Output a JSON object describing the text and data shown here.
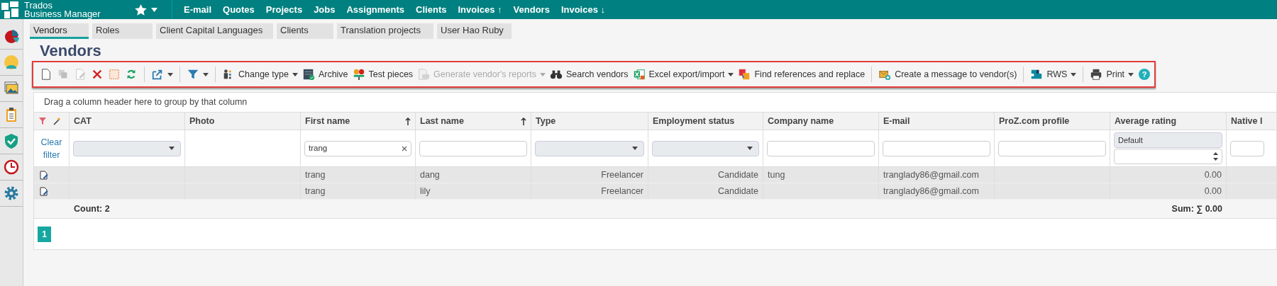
{
  "app": {
    "logo_line_1": "Trados",
    "logo_line_2": "Business Manager"
  },
  "nav": [
    "E-mail",
    "Quotes",
    "Projects",
    "Jobs",
    "Assignments",
    "Clients",
    "Invoices ↑",
    "Vendors",
    "Invoices ↓"
  ],
  "tabs": [
    {
      "label": "Vendors",
      "selected": true
    },
    {
      "label": "Roles",
      "selected": false
    },
    {
      "label": "Client Capital Languages",
      "selected": false
    },
    {
      "label": "Clients",
      "selected": false
    },
    {
      "label": "Translation projects",
      "selected": false
    },
    {
      "label": "User Hao Ruby",
      "selected": false
    }
  ],
  "page_title": "Vendors",
  "toolbar": [
    {
      "kind": "button",
      "disabled": false,
      "menu": false
    },
    {
      "kind": "button",
      "disabled": true,
      "menu": false
    },
    {
      "kind": "button",
      "disabled": true,
      "menu": false
    },
    {
      "kind": "button",
      "disabled": false,
      "menu": false
    },
    {
      "kind": "button",
      "disabled": false,
      "menu": false
    },
    {
      "kind": "button",
      "disabled": false,
      "menu": false
    },
    {
      "kind": "separator"
    },
    {
      "kind": "button",
      "disabled": false,
      "menu": true
    },
    {
      "kind": "separator"
    },
    {
      "kind": "button",
      "disabled": false,
      "menu": true
    },
    {
      "kind": "separator"
    },
    {
      "kind": "button",
      "label": "Change type",
      "disabled": false,
      "menu": true
    },
    {
      "kind": "button",
      "label": "Archive",
      "disabled": false,
      "menu": false
    },
    {
      "kind": "button",
      "label": "Test pieces",
      "disabled": false,
      "menu": false
    },
    {
      "kind": "button",
      "label": "Generate vendor's reports",
      "disabled": true,
      "menu": true
    },
    {
      "kind": "button",
      "label": "Search vendors",
      "disabled": false,
      "menu": false
    },
    {
      "kind": "button",
      "label": "Excel export/import",
      "disabled": false,
      "menu": true
    },
    {
      "kind": "button",
      "label": "Find references and replace",
      "disabled": false,
      "menu": false
    },
    {
      "kind": "separator"
    },
    {
      "kind": "button",
      "label": "Create a message to vendor(s)",
      "disabled": false,
      "menu": false
    },
    {
      "kind": "separator"
    },
    {
      "kind": "button",
      "label": "RWS",
      "disabled": false,
      "menu": true
    },
    {
      "kind": "separator"
    },
    {
      "kind": "button",
      "label": "Print",
      "disabled": false,
      "menu": true
    },
    {
      "kind": "help",
      "label": "?"
    }
  ],
  "grid": {
    "group_hint": "Drag a column header here to group by that column",
    "clear_filter": "Clear filter",
    "columns": [
      {
        "label": "CAT",
        "sort_ascending": false
      },
      {
        "label": "Photo",
        "sort_ascending": false
      },
      {
        "label": "First name",
        "sort_ascending": true
      },
      {
        "label": "Last name",
        "sort_ascending": true
      },
      {
        "label": "Type",
        "sort_ascending": false
      },
      {
        "label": "Employment status",
        "sort_ascending": false
      },
      {
        "label": "Company name",
        "sort_ascending": false
      },
      {
        "label": "E-mail",
        "sort_ascending": false
      },
      {
        "label": "ProZ.com profile",
        "sort_ascending": false
      },
      {
        "label": "Average rating",
        "sort_ascending": false
      },
      {
        "label": "Native l",
        "sort_ascending": false
      }
    ],
    "filters": [
      {
        "kind": "select"
      },
      {
        "kind": "none"
      },
      {
        "kind": "text",
        "value": "trang"
      },
      {
        "kind": "text"
      },
      {
        "kind": "select"
      },
      {
        "kind": "select"
      },
      {
        "kind": "text"
      },
      {
        "kind": "text"
      },
      {
        "kind": "text"
      },
      {
        "kind": "rating",
        "option": "Default"
      },
      {
        "kind": "text"
      }
    ],
    "rows": [
      {
        "cells": [
          "",
          "",
          "trang",
          "dang",
          "Freelancer",
          "Candidate",
          "tung",
          "tranglady86@gmail.com",
          "",
          "0.00",
          ""
        ]
      },
      {
        "cells": [
          "",
          "",
          "trang",
          "lily",
          "Freelancer",
          "Candidate",
          "",
          "tranglady86@gmail.com",
          "",
          "0.00",
          ""
        ]
      }
    ],
    "count": "Count: 2",
    "sum": "Sum: ∑ 0.00",
    "pages": [
      {
        "label": "1",
        "selected": true
      }
    ]
  }
}
